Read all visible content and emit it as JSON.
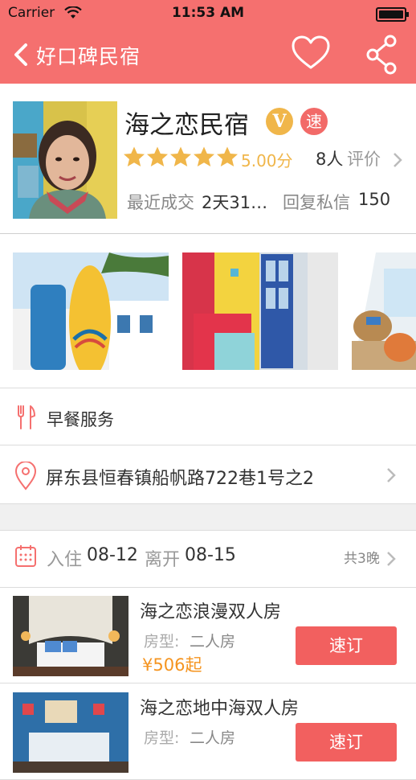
{
  "status_bar": {
    "carrier": "Carrier",
    "time": "11:53 AM"
  },
  "nav": {
    "back_label": "好口碑民宿",
    "favorite_icon": "heart-icon",
    "share_icon": "share-icon"
  },
  "header": {
    "name": "海之恋民宿",
    "badge_v": "V",
    "badge_fast": "速",
    "rating": 5,
    "score": "5.00分",
    "review_count": "8人",
    "review_label": "评价",
    "deal_label": "最近成交",
    "deal_value": "2天31…",
    "reply_label": "回复私信",
    "reply_value": "150"
  },
  "gallery": {
    "count": 3
  },
  "breakfast": {
    "label": "早餐服务",
    "icon": "fork-knife-icon"
  },
  "address": {
    "label": "屏东县恒春镇船帆路722巷1号之2",
    "icon": "location-pin-icon"
  },
  "dates": {
    "icon": "calendar-icon",
    "checkin_label": "入住",
    "checkin_value": "08-12",
    "checkout_label": "离开",
    "checkout_value": "08-15",
    "nights": "共3晚"
  },
  "rooms": [
    {
      "name": "海之恋浪漫双人房",
      "type_label": "房型:",
      "type_value": "二人房",
      "price": "¥506起",
      "book_label": "速订"
    },
    {
      "name": "海之恋地中海双人房",
      "type_label": "房型:",
      "type_value": "二人房",
      "price": "",
      "book_label": "速订"
    }
  ],
  "colors": {
    "primary": "#f5706f",
    "star": "#f0b64a",
    "price": "#f5941f",
    "book_button": "#f2605f"
  }
}
